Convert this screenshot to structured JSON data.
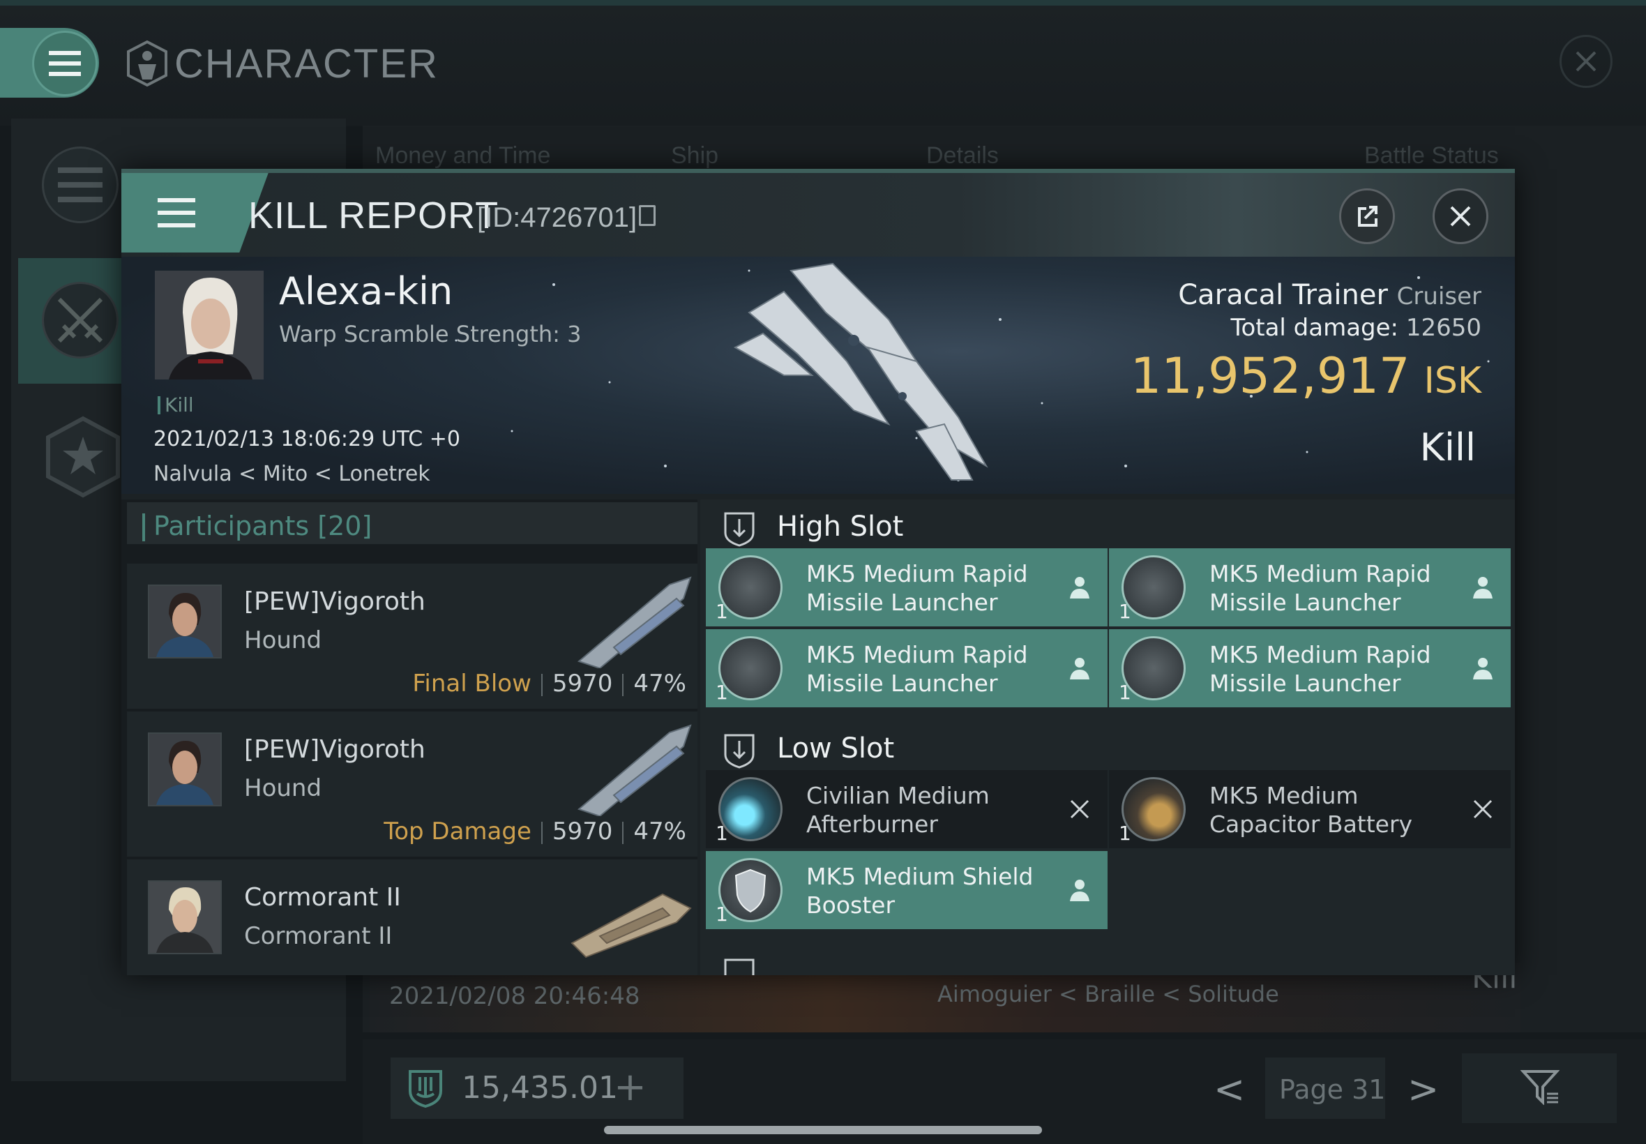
{
  "app": {
    "title": "CHARACTER"
  },
  "background_list": {
    "columns": [
      "Money and Time",
      "Ship",
      "Details",
      "Battle Status"
    ],
    "row": {
      "time": "2021/02/08  20:46:48",
      "location": "Aimoguier < Braille < Solitude",
      "status": "Kill"
    },
    "wallet": "15,435.01",
    "page_label": "Page 31"
  },
  "kill_report": {
    "title": "KILL REPORT",
    "id_label": "[ID:4726701]",
    "victim": {
      "name": "Alexa-kin",
      "warp_scramble": "Warp Scramble Strength: 3",
      "tag": "Kill",
      "timestamp": "2021/02/13 18:06:29 UTC +0",
      "location": "Nalvula < Mito < Lonetrek",
      "ship_name": "Caracal Trainer",
      "ship_class": "Cruiser",
      "total_damage_label": "Total damage:",
      "total_damage_value": "12650",
      "isk_value": "11,952,917",
      "isk_unit": "ISK",
      "result": "Kill"
    },
    "participants": {
      "title": "Participants [20]",
      "items": [
        {
          "name": "[PEW]Vigoroth",
          "ship": "Hound",
          "label": "Final Blow",
          "damage": "5970",
          "percent": "47%"
        },
        {
          "name": "[PEW]Vigoroth",
          "ship": "Hound",
          "label": "Top Damage",
          "damage": "5970",
          "percent": "47%"
        },
        {
          "name": "Cormorant II",
          "ship": "Cormorant II",
          "label": "",
          "damage": "",
          "percent": ""
        }
      ]
    },
    "fitting": {
      "high_slot": {
        "title": "High Slot",
        "modules": [
          {
            "name": "MK5 Medium Rapid Missile Launcher",
            "qty": "1",
            "status": "dropped"
          },
          {
            "name": "MK5 Medium Rapid Missile Launcher",
            "qty": "1",
            "status": "dropped"
          },
          {
            "name": "MK5 Medium Rapid Missile Launcher",
            "qty": "1",
            "status": "dropped"
          },
          {
            "name": "MK5 Medium Rapid Missile Launcher",
            "qty": "1",
            "status": "dropped"
          }
        ]
      },
      "low_slot": {
        "title": "Low Slot",
        "modules": [
          {
            "name": "Civilian Medium Afterburner",
            "qty": "1",
            "status": "destroyed"
          },
          {
            "name": "MK5 Medium Capacitor Battery",
            "qty": "1",
            "status": "destroyed"
          },
          {
            "name": "MK5 Medium Shield Booster",
            "qty": "1",
            "status": "dropped"
          }
        ]
      }
    }
  },
  "colors": {
    "accent": "#4a8479",
    "isk_gold": "#e9c56c",
    "final_blow": "#cfa14e"
  }
}
